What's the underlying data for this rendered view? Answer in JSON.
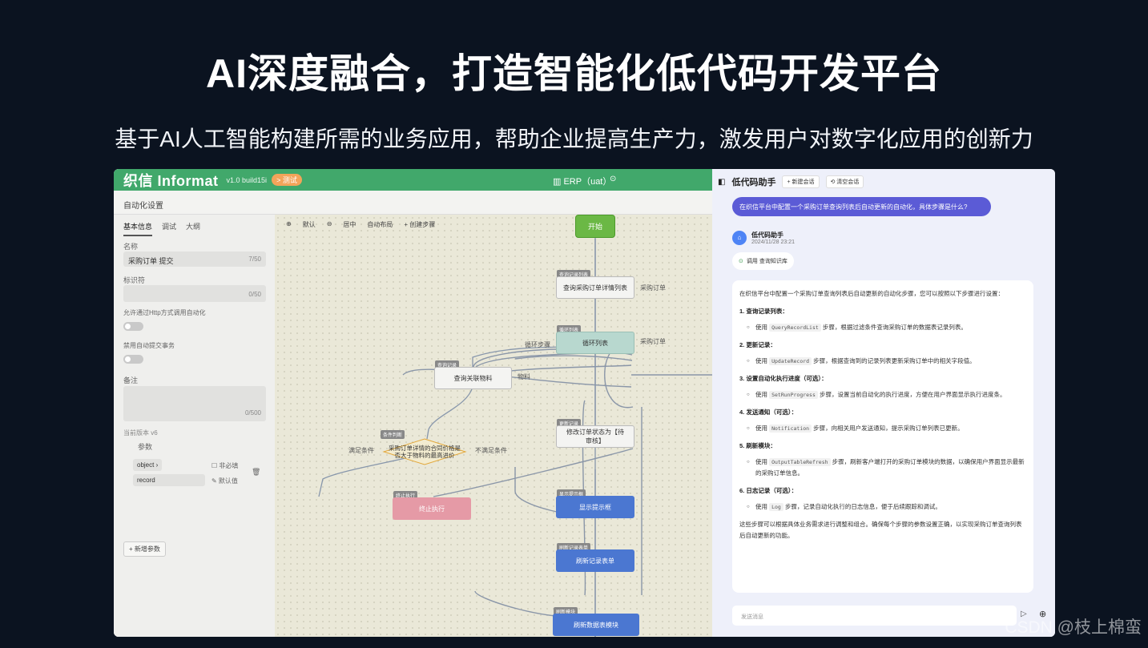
{
  "hero": {
    "title": "AI深度融合，打造智能化低代码开发平台",
    "subtitle": "基于AI人工智能构建所需的业务应用，帮助企业提高生产力，激发用户对数字化应用的创新力"
  },
  "app": {
    "logo": "织信 Informat",
    "version": "v1.0 build15i",
    "env_badge": "> 测试",
    "project": "ERP（uat）",
    "breadcrumb": "自动化设置",
    "tabs": [
      "基本信息",
      "调试",
      "大纲"
    ],
    "name_label": "名称",
    "name_value": "采购订单 提交",
    "name_count": "7/50",
    "id_label": "标识符",
    "id_count": "0/50",
    "http_label": "允许通过Http方式调用自动化",
    "tx_label": "禁用自动提交事务",
    "remark_label": "备注",
    "remark_count": "0/500",
    "current_version": "当前版本 v6",
    "params_label": "参数",
    "param_type": "object",
    "param_required": "非必填",
    "param_name": "record",
    "param_default": "✎ 默认值",
    "add_param": "+ 新增参数",
    "canvas_toolbar": [
      "⊕",
      "默认",
      "⊖",
      "居中",
      "自动布局",
      "+ 创建步骤"
    ],
    "nodes": {
      "start": "开始",
      "query": "查询采购订单详情列表",
      "loop": "循环列表",
      "assoc": "查询关联物料",
      "cond": "采购订单详情的合同价格是否大于物料的最高进价",
      "stop": "终止执行",
      "update": "修改订单状态为【待审核】",
      "toast": "显示提示框",
      "refresh": "刷新记录表单",
      "module": "刷新数据表模块"
    },
    "tags": {
      "query": "查询记录列表",
      "loop": "循环列表",
      "assoc": "查询记录",
      "cond": "条件判断",
      "stop": "终止执行",
      "update": "更新记录",
      "toast": "显示提示框",
      "refresh": "刷新记录表单",
      "module": "刷新模块"
    },
    "notes": {
      "loop_step": "循环步骤",
      "meet": "满足条件",
      "not_meet": "不满足条件",
      "q_right": "采购订单",
      "l_right": "采购订单",
      "material": "物料"
    }
  },
  "chat": {
    "title": "低代码助手",
    "new_btn": "+ 新建会话",
    "clear_btn": "⟲ 清空会话",
    "user_msg": "在织信平台中配置一个采购订单查询列表后自动更新的自动化，具体步骤是什么?",
    "bot_name": "低代码助手",
    "bot_time": "2024/11/28 23:21",
    "tool_call": "调用 查询知识库",
    "intro": "在织信平台中配置一个采购订单查询列表后自动更新的自动化步骤，您可以按照以下步骤进行设置：",
    "steps": [
      {
        "h": "1. 查询记录列表：",
        "pre": "使用",
        "code": "QueryRecordList",
        "post": "步骤，根据过滤条件查询采购订单的数据表记录列表。"
      },
      {
        "h": "2. 更新记录：",
        "pre": "使用",
        "code": "UpdateRecord",
        "post": "步骤，根据查询到的记录列表更新采购订单中的相关字段值。"
      },
      {
        "h": "3. 设置自动化执行进度（可选）：",
        "pre": "使用",
        "code": "SetRunProgress",
        "post": "步骤，设置当前自动化的执行进度，方便在用户界面显示执行进度条。"
      },
      {
        "h": "4. 发送通知（可选）：",
        "pre": "使用",
        "code": "Notification",
        "post": "步骤，向相关用户发送通知，提示采购订单列表已更新。"
      },
      {
        "h": "5. 刷新模块：",
        "pre": "使用",
        "code": "OutputTableRefresh",
        "post": "步骤，刷新客户端打开的采购订单模块的数据，以确保用户界面显示最新的采购订单信息。"
      },
      {
        "h": "6. 日志记录（可选）：",
        "pre": "使用",
        "code": "Log",
        "post": "步骤，记录自动化执行的日志信息，便于后续跟踪和调试。"
      }
    ],
    "outro": "这些步骤可以根据具体业务需求进行调整和组合。确保每个步骤的参数设置正确，以实现采购订单查询列表后自动更新的功能。",
    "input_placeholder": "发送消息"
  },
  "watermark": "CSDN @枝上棉蛮"
}
